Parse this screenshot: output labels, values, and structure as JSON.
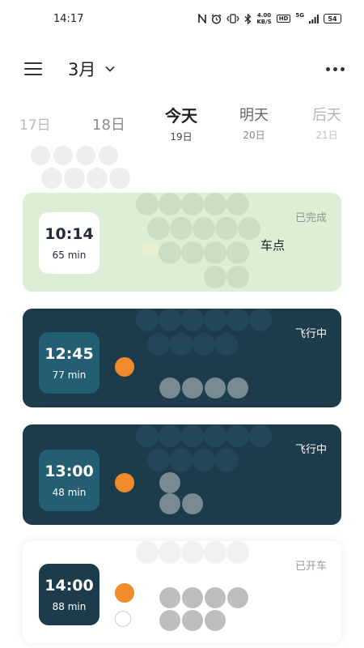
{
  "status_bar": {
    "time": "14:17",
    "net_speed_top": "4.00",
    "net_speed_bottom": "KB/S",
    "hd": "HD",
    "network": "5G",
    "battery": "54"
  },
  "header": {
    "month": "3月",
    "menu_icon": "menu-icon",
    "more_icon": "more-icon"
  },
  "dates": [
    {
      "label": "17日",
      "sub": ""
    },
    {
      "label": "18日",
      "sub": ""
    },
    {
      "label": "今天",
      "sub": "19日"
    },
    {
      "label": "明天",
      "sub": "20日"
    },
    {
      "label": "后天",
      "sub": "21日"
    }
  ],
  "trips": [
    {
      "time": "10:14",
      "duration": "65 min",
      "status": "已完成",
      "dest_fragment": "车点"
    },
    {
      "time": "12:45",
      "duration": "77 min",
      "status": "飞行中"
    },
    {
      "time": "13:00",
      "duration": "48 min",
      "status": "飞行中"
    },
    {
      "time": "14:00",
      "duration": "88 min",
      "status": "已开车"
    }
  ],
  "colors": {
    "done_card": "#dcefd6",
    "dark_card": "#1c3c4b",
    "dark_time_box": "#245e73",
    "accent_orange": "#f08a2a"
  }
}
